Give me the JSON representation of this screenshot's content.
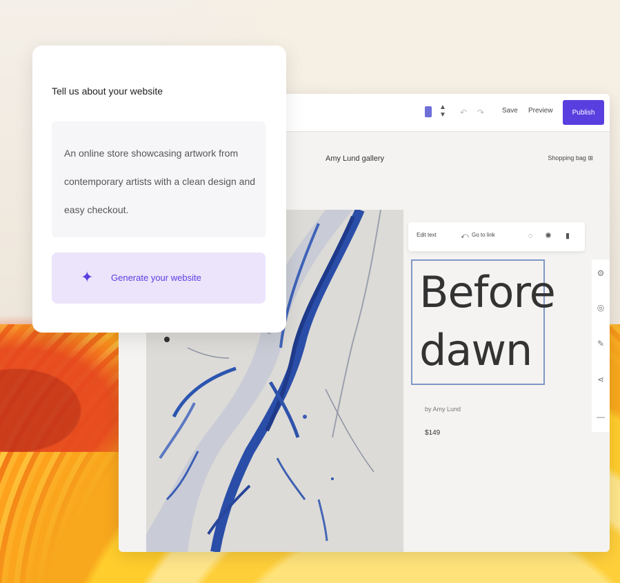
{
  "card": {
    "title": "Tell us about your website",
    "prompt_text": "An online store showcasing artwork from contemporary artists with a clean design and easy checkout.",
    "generate_label": "Generate your website",
    "generate_icon": "sparkle-icon"
  },
  "editor": {
    "toolbar": {
      "device_icon": "mobile-icon",
      "undo_icon": "undo-icon",
      "redo_icon": "redo-icon",
      "save_label": "Save",
      "preview_label": "Preview",
      "publish_label": "Publish"
    },
    "site": {
      "title": "Amy Lund gallery",
      "cart_label": "Shopping bag"
    },
    "text_toolbar": {
      "edit_label": "Edit text",
      "link_label": "Go to link"
    },
    "heading": "Before dawn",
    "byline": "by Amy Lund",
    "price": "$149"
  },
  "colors": {
    "accent": "#5a3fe0",
    "accent_light": "#ebe4fb",
    "heading": "#333333",
    "selection_border": "#7e96c6"
  }
}
